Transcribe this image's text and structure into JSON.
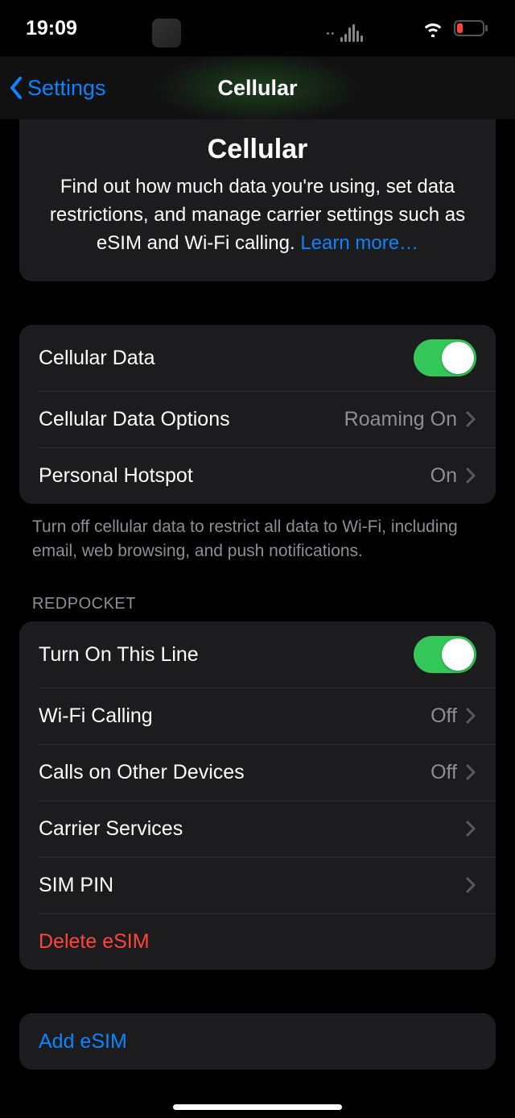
{
  "status": {
    "time": "19:09"
  },
  "nav": {
    "back_label": "Settings",
    "title": "Cellular"
  },
  "intro": {
    "title": "Cellular",
    "body": "Find out how much data you're using, set data restrictions, and manage carrier settings such as eSIM and Wi-Fi calling. ",
    "learn_more": "Learn more…"
  },
  "section1": {
    "items": [
      {
        "label": "Cellular Data",
        "type": "toggle",
        "on": true
      },
      {
        "label": "Cellular Data Options",
        "value": "Roaming On",
        "type": "nav"
      },
      {
        "label": "Personal Hotspot",
        "value": "On",
        "type": "nav"
      }
    ],
    "footer": "Turn off cellular data to restrict all data to Wi-Fi, including email, web browsing, and push notifications."
  },
  "section2": {
    "header": "REDPOCKET",
    "items": [
      {
        "label": "Turn On This Line",
        "type": "toggle",
        "on": true
      },
      {
        "label": "Wi-Fi Calling",
        "value": "Off",
        "type": "nav"
      },
      {
        "label": "Calls on Other Devices",
        "value": "Off",
        "type": "nav"
      },
      {
        "label": "Carrier Services",
        "type": "nav"
      },
      {
        "label": "SIM PIN",
        "type": "nav"
      },
      {
        "label": "Delete eSIM",
        "type": "destructive"
      }
    ]
  },
  "section3": {
    "items": [
      {
        "label": "Add eSIM",
        "type": "link"
      }
    ]
  }
}
